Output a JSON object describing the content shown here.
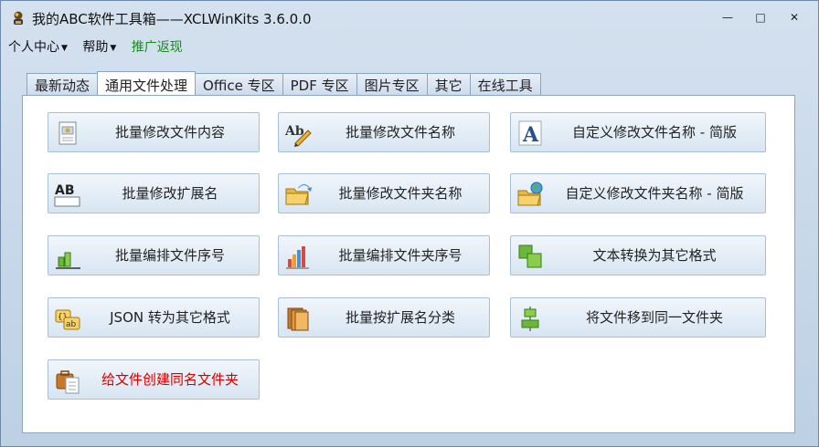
{
  "window": {
    "title": "我的ABC软件工具箱——XCLWinKits  3.6.0.0",
    "minimize": "—",
    "maximize": "□",
    "close": "✕"
  },
  "menu": [
    {
      "label": "个人中心",
      "caret": "▼"
    },
    {
      "label": "帮助",
      "caret": "▼"
    },
    {
      "label": "推广返现",
      "caret": ""
    }
  ],
  "tabs": [
    "最新动态",
    "通用文件处理",
    "Office 专区",
    "PDF 专区",
    "图片专区",
    "其它",
    "在线工具"
  ],
  "active_tab": "通用文件处理",
  "colors": {
    "promo": "#1a8a1a",
    "highlight_text": "#d40000"
  },
  "tools": [
    {
      "label": "批量修改文件内容",
      "icon": "document-icon"
    },
    {
      "label": "批量修改文件名称",
      "icon": "rename-pen-icon"
    },
    {
      "label": "自定义修改文件名称 - 简版",
      "icon": "letter-a-icon"
    },
    {
      "label": "批量修改扩展名",
      "icon": "ab-extension-icon"
    },
    {
      "label": "批量修改文件夹名称",
      "icon": "folder-arrow-icon"
    },
    {
      "label": "自定义修改文件夹名称 - 简版",
      "icon": "folder-globe-icon"
    },
    {
      "label": "批量编排文件序号",
      "icon": "bar-chart-green-icon"
    },
    {
      "label": "批量编排文件夹序号",
      "icon": "bar-chart-color-icon"
    },
    {
      "label": "文本转换为其它格式",
      "icon": "green-squares-icon"
    },
    {
      "label": "JSON 转为其它格式",
      "icon": "json-ab-icon"
    },
    {
      "label": "批量按扩展名分类",
      "icon": "stacked-books-icon"
    },
    {
      "label": "将文件移到同一文件夹",
      "icon": "align-blocks-icon"
    },
    {
      "label": "给文件创建同名文件夹",
      "icon": "briefcase-docs-icon",
      "highlight": true
    }
  ]
}
